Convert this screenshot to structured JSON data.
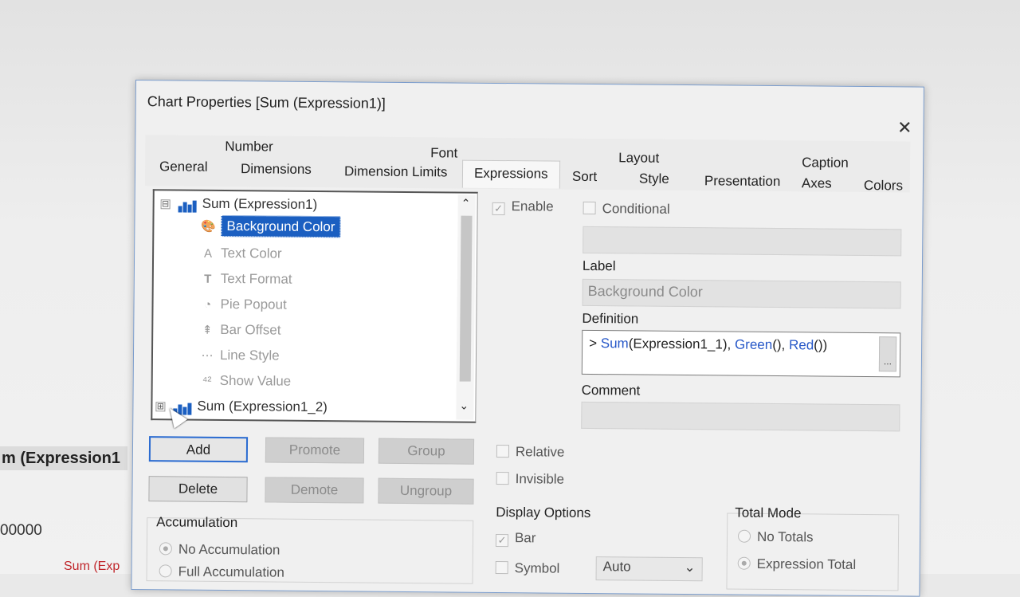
{
  "background_app": {
    "header_text": "m (Expression1",
    "value_text": "00000",
    "red_text": "Sum (Exp"
  },
  "dialog": {
    "title": "Chart Properties [Sum (Expression1)]",
    "close_glyph": "✕",
    "tabs_top": [
      "Number",
      "Font",
      "Layout",
      "Caption"
    ],
    "tabs_bottom": [
      "General",
      "Dimensions",
      "Dimension Limits",
      "Expressions",
      "Sort",
      "Style",
      "Presentation",
      "Axes",
      "Colors"
    ],
    "active_tab": "Expressions"
  },
  "tree": {
    "expression1": "Sum (Expression1)",
    "items": [
      "Background Color",
      "Text Color",
      "Text Format",
      "Pie Popout",
      "Bar Offset",
      "Line Style",
      "Show Value"
    ],
    "expression2": "Sum (Expression1_2)",
    "expander_collapse": "⊟",
    "expander_expand": "⊞",
    "scroll_up": "⌃",
    "scroll_down": "⌄"
  },
  "buttons": {
    "add": "Add",
    "promote": "Promote",
    "group": "Group",
    "delete": "Delete",
    "demote": "Demote",
    "ungroup": "Ungroup"
  },
  "options": {
    "enable": "Enable",
    "conditional": "Conditional",
    "relative": "Relative",
    "invisible": "Invisible",
    "label_title": "Label",
    "label_value": "Background Color",
    "definition_title": "Definition",
    "definition_prefix": "> ",
    "definition_fn1": "Sum",
    "definition_mid1": "(Expression1_1), ",
    "definition_fn2": "Green",
    "definition_mid2": "(), ",
    "definition_fn3": "Red",
    "definition_end": "())",
    "definition_button": "...",
    "comment_title": "Comment"
  },
  "accumulation": {
    "title": "Accumulation",
    "options": [
      "No Accumulation",
      "Full Accumulation"
    ]
  },
  "display_options": {
    "title": "Display Options",
    "bar": "Bar",
    "symbol": "Symbol",
    "symbol_select": "Auto"
  },
  "total_mode": {
    "title": "Total Mode",
    "options": [
      "No Totals",
      "Expression Total"
    ]
  }
}
